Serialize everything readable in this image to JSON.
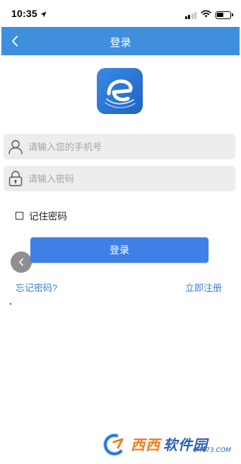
{
  "status_bar": {
    "time": "10:35",
    "location_icon": "location-arrow-icon",
    "signal_icon": "cellular-signal-icon",
    "wifi_icon": "wifi-icon",
    "battery_icon": "battery-icon",
    "battery_level": 0.4
  },
  "nav": {
    "title": "登录",
    "back_icon": "chevron-left-icon"
  },
  "logo": {
    "icon": "e-app-logo-icon",
    "color": "#2d78d6"
  },
  "form": {
    "phone_placeholder": "请输入您的手机号",
    "phone_value": "",
    "phone_icon": "user-icon",
    "password_placeholder": "请输入密码",
    "password_value": "",
    "password_icon": "lock-icon",
    "remember_label": "记住密码",
    "remember_checked": false,
    "login_label": "登录"
  },
  "links": {
    "forgot": "忘记密码?",
    "register": "立即注册"
  },
  "floating_back": {
    "icon": "chevron-left-icon"
  },
  "watermark": {
    "text_main_1": "西西",
    "text_main_2": "软件园",
    "text_sub": "CR173.COM"
  },
  "colors": {
    "primary": "#3f8fdc",
    "button": "#3f80e6",
    "link": "#3b7fd1",
    "input_bg": "#ededed"
  }
}
